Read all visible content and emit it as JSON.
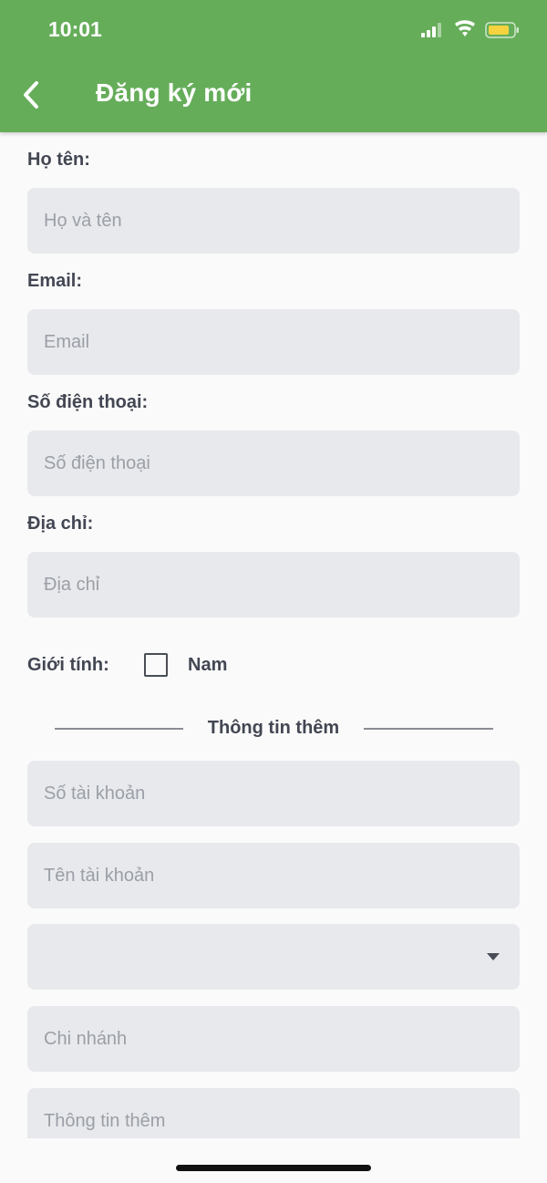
{
  "status_bar": {
    "time": "10:01"
  },
  "header": {
    "title": "Đăng ký mới",
    "back_icon": "chevron-left-icon"
  },
  "form": {
    "full_name": {
      "label": "Họ tên:",
      "placeholder": "Họ và tên"
    },
    "email": {
      "label": "Email:",
      "placeholder": "Email"
    },
    "phone": {
      "label": "Số điện thoại:",
      "placeholder": "Số điện thoại"
    },
    "address": {
      "label": "Địa chỉ:",
      "placeholder": "Địa chỉ"
    },
    "gender": {
      "label": "Giới tính:",
      "option_label": "Nam",
      "checked": false
    }
  },
  "extra_section": {
    "title": "Thông tin thêm",
    "account_number": {
      "placeholder": "Số tài khoản"
    },
    "account_name": {
      "placeholder": "Tên tài khoản"
    },
    "bank_select": {
      "selected": ""
    },
    "branch": {
      "placeholder": "Chi nhánh"
    },
    "more_info": {
      "placeholder": "Thông tin thêm"
    }
  },
  "colors": {
    "header_bg": "#66ad5a",
    "input_bg": "#e7e9ec",
    "placeholder": "#9b9fa6",
    "label": "#434753"
  }
}
